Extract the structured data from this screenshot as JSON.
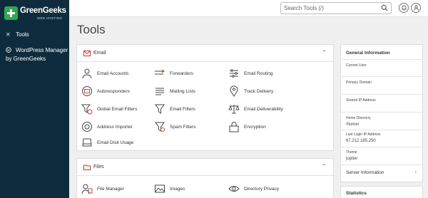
{
  "brand": {
    "name": "GreenGeeks",
    "sub": "WEB HOSTING"
  },
  "nav": {
    "tools": "Tools",
    "wp_line1": "WordPress Manager",
    "wp_line2": "by GreenGeeks"
  },
  "search": {
    "placeholder": "Search Tools (/)"
  },
  "page": {
    "title": "Tools"
  },
  "email": {
    "title": "Email",
    "tools": [
      "Email Accounts",
      "Forwarders",
      "Email Routing",
      "Autoresponders",
      "Mailing Lists",
      "Track Delivery",
      "Global Email Filters",
      "Email Filters",
      "Email Deliverability",
      "Address Importer",
      "Spam Filters",
      "Encryption",
      "Email Disk Usage"
    ]
  },
  "files": {
    "title": "Files",
    "tools": [
      "File Manager",
      "Images",
      "Directory Privacy"
    ]
  },
  "info": {
    "title": "General Information",
    "current_user_label": "Current User",
    "primary_domain_label": "Primary Domain",
    "shared_ip_label": "Shared IP Address",
    "home_dir_label": "Home Directory",
    "home_dir_value": "/home/",
    "last_login_label": "Last Login IP Address",
    "last_login_value": "67.212.185.250",
    "theme_label": "Theme",
    "theme_value": "jupiter",
    "server_info": "Server Information"
  },
  "stats": {
    "title": "Statistics"
  },
  "colors": {
    "sidebar": "#0e2c3d",
    "brand_green": "#2fa84f",
    "email_icon": "#c0392b"
  }
}
